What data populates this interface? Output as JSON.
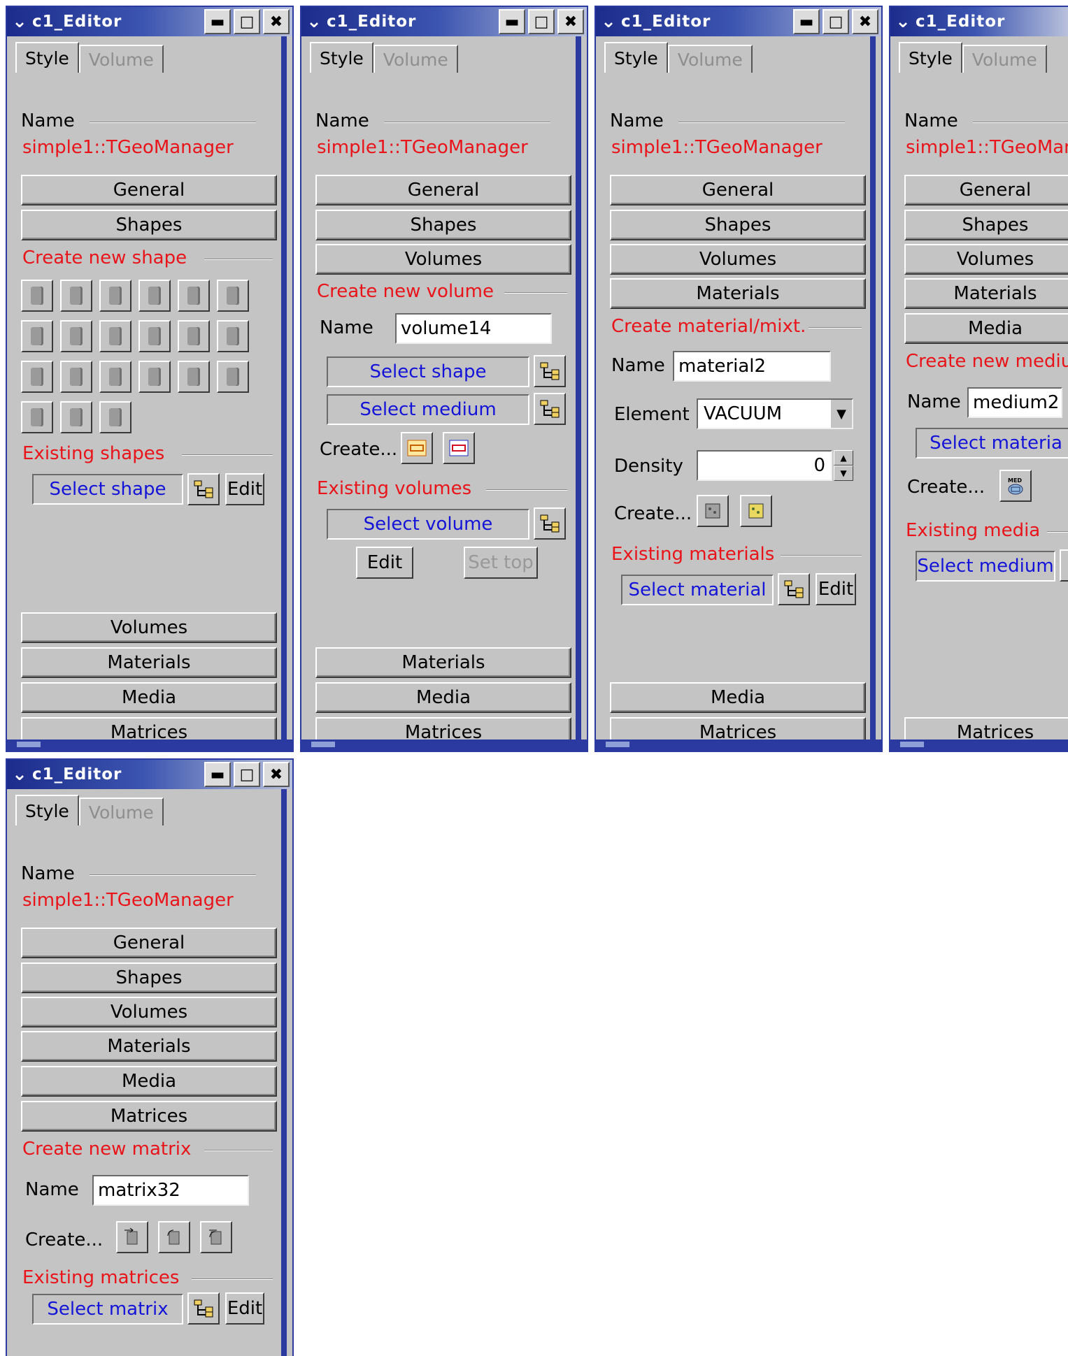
{
  "windows": [
    {
      "title": "c1_Editor",
      "tabs": [
        "Style",
        "Volume"
      ],
      "name_label": "Name",
      "object_name": "simple1::TGeoManager",
      "top_buttons": [
        "General",
        "Shapes"
      ],
      "create_section": "Create new shape",
      "existing_section": "Existing shapes",
      "select_label": "Select shape",
      "edit_label": "Edit",
      "bottom_buttons": [
        "Volumes",
        "Materials",
        "Media",
        "Matrices"
      ]
    },
    {
      "title": "c1_Editor",
      "tabs": [
        "Style",
        "Volume"
      ],
      "name_label": "Name",
      "object_name": "simple1::TGeoManager",
      "top_buttons": [
        "General",
        "Shapes",
        "Volumes"
      ],
      "create_section": "Create new volume",
      "field_label": "Name",
      "field_value": "volume14",
      "select_shape": "Select shape",
      "select_medium": "Select medium",
      "create_label": "Create...",
      "existing_section": "Existing volumes",
      "select_label": "Select volume",
      "edit_label": "Edit",
      "settop_label": "Set top",
      "bottom_buttons": [
        "Materials",
        "Media",
        "Matrices"
      ]
    },
    {
      "title": "c1_Editor",
      "tabs": [
        "Style",
        "Volume"
      ],
      "name_label": "Name",
      "object_name": "simple1::TGeoManager",
      "top_buttons": [
        "General",
        "Shapes",
        "Volumes",
        "Materials"
      ],
      "create_section": "Create material/mixt.",
      "field_label": "Name",
      "field_value": "material2",
      "element_label": "Element",
      "element_value": "VACUUM",
      "density_label": "Density",
      "density_value": "0",
      "create_label": "Create...",
      "existing_section": "Existing materials",
      "select_label": "Select material",
      "edit_label": "Edit",
      "bottom_buttons": [
        "Media",
        "Matrices"
      ]
    },
    {
      "title": "c1_Editor",
      "tabs": [
        "Style",
        "Volume"
      ],
      "name_label": "Name",
      "object_name": "simple1::TGeoMan",
      "top_buttons": [
        "General",
        "Shapes",
        "Volumes",
        "Materials",
        "Media"
      ],
      "create_section": "Create new mediu",
      "field_label": "Name",
      "field_value": "medium2",
      "select_material": "Select materia",
      "create_label": "Create...",
      "existing_section": "Existing media",
      "select_label": "Select medium",
      "bottom_buttons": [
        "Matrices"
      ]
    },
    {
      "title": "c1_Editor",
      "tabs": [
        "Style",
        "Volume"
      ],
      "name_label": "Name",
      "object_name": "simple1::TGeoManager",
      "top_buttons": [
        "General",
        "Shapes",
        "Volumes",
        "Materials",
        "Media",
        "Matrices"
      ],
      "create_section": "Create new matrix",
      "field_label": "Name",
      "field_value": "matrix32",
      "create_label": "Create...",
      "existing_section": "Existing matrices",
      "select_label": "Select matrix",
      "edit_label": "Edit"
    }
  ],
  "icons": {
    "menu": "chevron-down-icon",
    "minimize": "minimize-icon",
    "maximize": "maximize-icon",
    "close": "close-icon",
    "browse": "tree-browse-icon"
  },
  "colors": {
    "section_red": "#e8141a",
    "select_blue": "#1414d8",
    "titlebar": "#1c2c8c",
    "window_bg": "#c4c4c4"
  }
}
